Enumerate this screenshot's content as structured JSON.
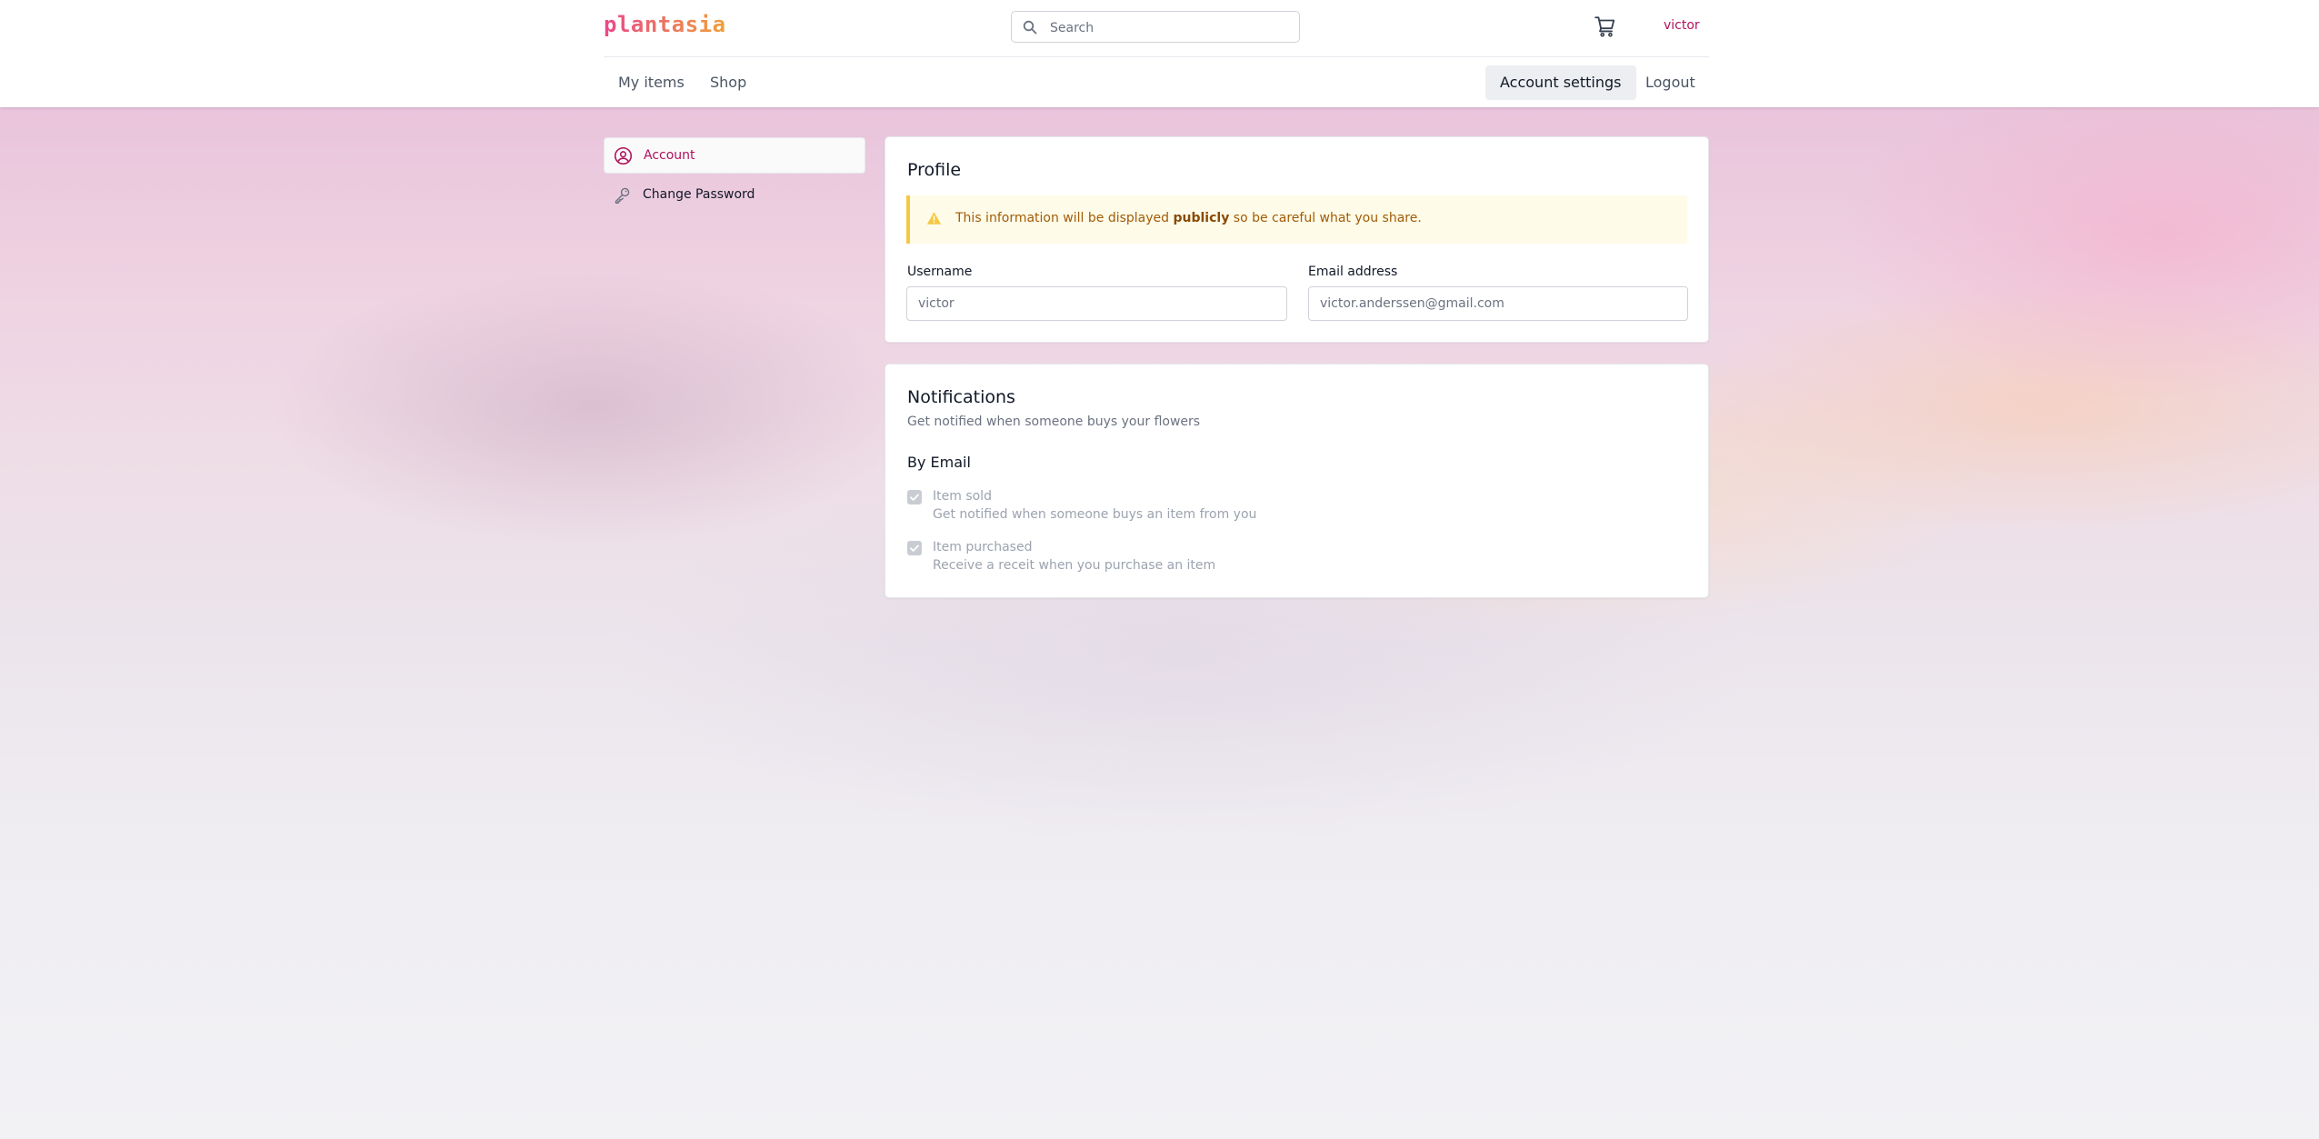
{
  "header": {
    "logo": "plantasia",
    "search_placeholder": "Search",
    "user": "victor",
    "cart_icon": "cart-icon"
  },
  "nav": {
    "left": [
      "My items",
      "Shop"
    ],
    "right": [
      "Account settings",
      "Logout"
    ],
    "active": "Account settings"
  },
  "sidebar": {
    "items": [
      {
        "label": "Account",
        "icon": "user-circle-icon",
        "active": true
      },
      {
        "label": "Change Password",
        "icon": "key-icon",
        "active": false
      }
    ]
  },
  "profile": {
    "title": "Profile",
    "notice_before": "This information will be displayed ",
    "notice_bold": "publicly",
    "notice_after": " so be careful what you share.",
    "username_label": "Username",
    "username_value": "victor",
    "email_label": "Email address",
    "email_value": "victor.anderssen@gmail.com"
  },
  "notifications": {
    "title": "Notifications",
    "subtitle": "Get notified when someone buys your flowers",
    "section": "By Email",
    "options": [
      {
        "title": "Item sold",
        "desc": "Get notified when someone buys an item from you",
        "checked": true
      },
      {
        "title": "Item purchased",
        "desc": "Receive a receit when you purchase an item",
        "checked": true
      }
    ]
  },
  "colors": {
    "accent": "#b0125c",
    "warning_text": "#a15c07",
    "warning_bg": "#fefbe8",
    "warning_border": "#f5c842"
  }
}
